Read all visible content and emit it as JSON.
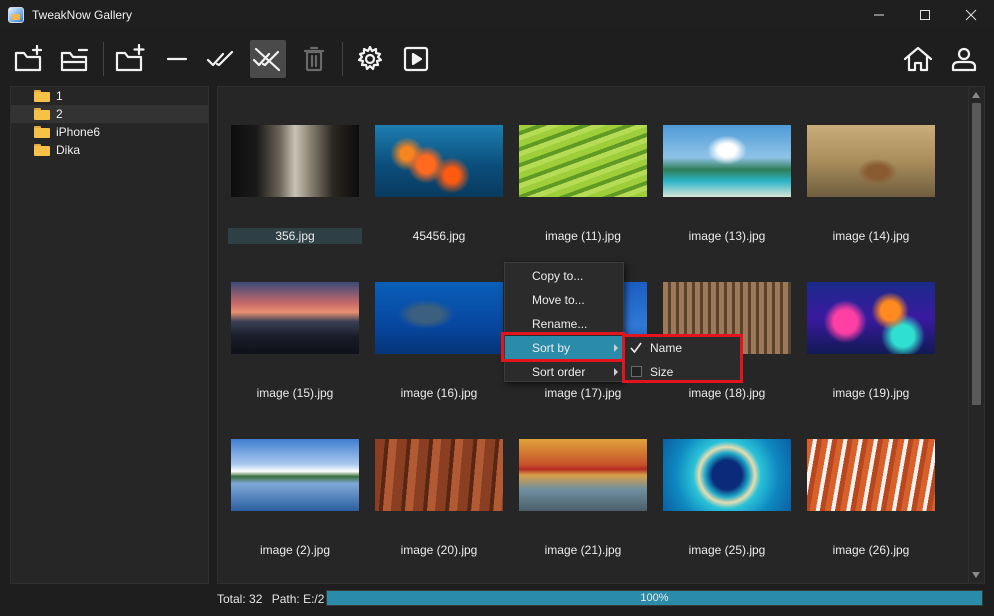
{
  "window": {
    "title": "TweakNow Gallery"
  },
  "toolbar": {
    "buttons": [
      "add-folder-icon",
      "open-folder-icon",
      "add-album-icon",
      "remove-icon",
      "select-all-icon",
      "deselect-all-icon",
      "trash-icon",
      "settings-icon",
      "slideshow-icon",
      "home-icon",
      "user-icon"
    ]
  },
  "tree": {
    "items": [
      {
        "label": "1"
      },
      {
        "label": "2"
      },
      {
        "label": "iPhone6"
      },
      {
        "label": "Dika"
      }
    ]
  },
  "gallery": {
    "items": [
      {
        "label": "356.jpg",
        "selected": true
      },
      {
        "label": "45456.jpg"
      },
      {
        "label": "image (11).jpg"
      },
      {
        "label": "image (13).jpg"
      },
      {
        "label": "image (14).jpg"
      },
      {
        "label": "image (15).jpg"
      },
      {
        "label": "image (16).jpg"
      },
      {
        "label": "image (17).jpg"
      },
      {
        "label": "image (18).jpg"
      },
      {
        "label": "image (19).jpg"
      },
      {
        "label": "image (2).jpg"
      },
      {
        "label": "image (20).jpg"
      },
      {
        "label": "image (21).jpg"
      },
      {
        "label": "image (25).jpg"
      },
      {
        "label": "image (26).jpg"
      }
    ]
  },
  "context_menu": {
    "items": [
      {
        "label": "Copy to..."
      },
      {
        "label": "Move to..."
      },
      {
        "label": "Rename..."
      },
      {
        "label": "Sort by",
        "submenu": true,
        "highlighted": true
      },
      {
        "label": "Sort order",
        "submenu": true
      }
    ],
    "sort_by": [
      {
        "label": "Name",
        "checked": true
      },
      {
        "label": "Size",
        "checked": false
      }
    ]
  },
  "status": {
    "total": "Total: 32",
    "path": "Path: E:/2",
    "progress_text": "100%",
    "progress_value": 1.0
  },
  "colors": {
    "accent": "#2a8ca8",
    "highlight_box": "#e3141e",
    "folder": "#f5c147"
  }
}
